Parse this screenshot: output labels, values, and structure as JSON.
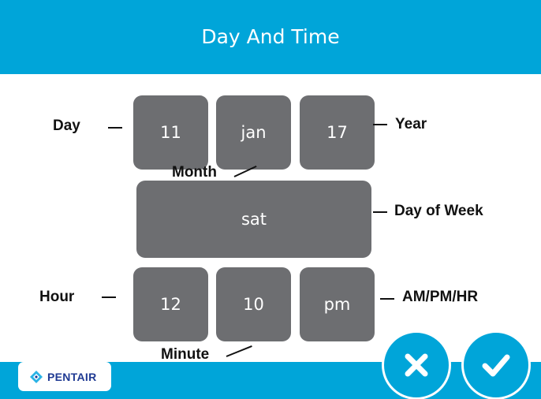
{
  "header": {
    "title": "Day And Time"
  },
  "fields": {
    "day": "11",
    "month": "jan",
    "year": "17",
    "day_of_week": "sat",
    "hour": "12",
    "minute": "10",
    "ampm": "pm"
  },
  "annotations": {
    "day": "Day",
    "month": "Month",
    "year": "Year",
    "day_of_week": "Day of Week",
    "hour": "Hour",
    "minute": "Minute",
    "ampm": "AM/PM/HR"
  },
  "footer": {
    "logo_text": "PENTAIR",
    "cancel_icon": "close-icon",
    "confirm_icon": "check-icon"
  },
  "colors": {
    "header": "#00a5d9",
    "tile": "#6d6e71",
    "logo_text": "#1f3a93",
    "logo_mark": "#2bb3e6"
  }
}
